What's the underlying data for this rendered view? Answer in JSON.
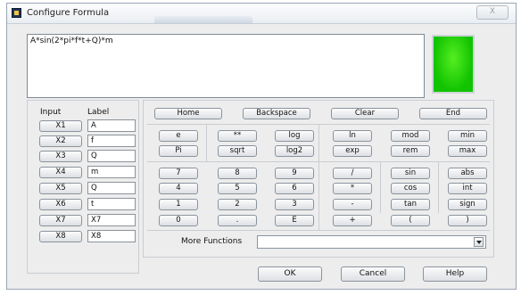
{
  "window": {
    "title": "Configure Formula",
    "close_label": "X"
  },
  "formula": {
    "text": "A*sin(2*pi*f*t+Q)*m"
  },
  "input_table": {
    "input_header": "Input",
    "label_header": "Label",
    "rows": [
      {
        "input": "X1",
        "label": "A"
      },
      {
        "input": "X2",
        "label": "f"
      },
      {
        "input": "X3",
        "label": "Q"
      },
      {
        "input": "X4",
        "label": "m"
      },
      {
        "input": "X5",
        "label": "Q"
      },
      {
        "input": "X6",
        "label": "t"
      },
      {
        "input": "X7",
        "label": "X7"
      },
      {
        "input": "X8",
        "label": "X8"
      }
    ]
  },
  "edit_buttons": {
    "home": "Home",
    "backspace": "Backspace",
    "clear": "Clear",
    "end": "End"
  },
  "function_buttons": {
    "e": "e",
    "pi": "Pi",
    "power": "**",
    "sqrt": "sqrt",
    "log": "log",
    "log2": "log2",
    "ln": "ln",
    "exp": "exp",
    "mod": "mod",
    "rem": "rem",
    "min": "min",
    "max": "max"
  },
  "keypad": {
    "d7": "7",
    "d8": "8",
    "d9": "9",
    "d4": "4",
    "d5": "5",
    "d6": "6",
    "d1": "1",
    "d2": "2",
    "d3": "3",
    "d0": "0",
    "dot": ".",
    "exp_e": "E"
  },
  "operators": {
    "divide": "/",
    "multiply": "*",
    "minus": "-",
    "plus": "+"
  },
  "trig": {
    "sin": "sin",
    "cos": "cos",
    "tan": "tan",
    "lparen": "("
  },
  "misc": {
    "abs": "abs",
    "int": "int",
    "sign": "sign",
    "rparen": ")"
  },
  "more_functions": {
    "label": "More Functions",
    "value": ""
  },
  "dialog": {
    "ok": "OK",
    "cancel": "Cancel",
    "help": "Help"
  },
  "colors": {
    "preview": "#1ec80b",
    "panel_bg": "#ededed"
  }
}
